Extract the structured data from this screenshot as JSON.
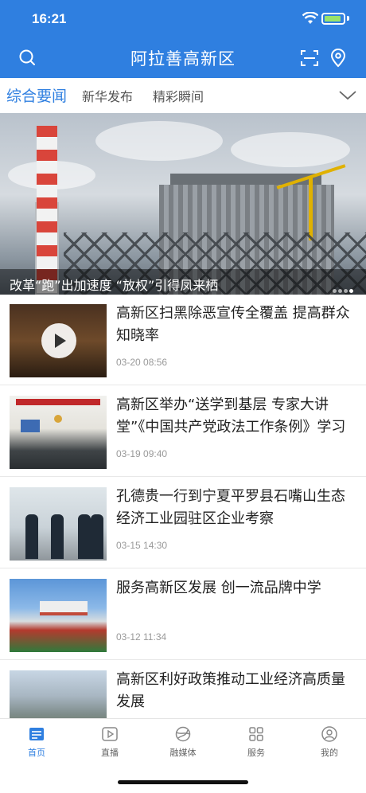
{
  "status_bar": {
    "time": "16:21"
  },
  "header": {
    "title": "阿拉善高新区"
  },
  "tabs": [
    {
      "label": "综合要闻",
      "active": true
    },
    {
      "label": "新华发布",
      "active": false
    },
    {
      "label": "精彩瞬间",
      "active": false
    }
  ],
  "hero": {
    "caption": "改革“跑”出加速度 “放权”引得凤来栖",
    "slide_count": 4,
    "current_slide": 4
  },
  "news": [
    {
      "title": "高新区扫黑除恶宣传全覆盖 提高群众知晓率",
      "date": "03-20 08:56",
      "video": true
    },
    {
      "title": "高新区举办“送学到基层 专家大讲堂”《中国共产党政法工作条例》学习",
      "date": "03-19 09:40",
      "video": false
    },
    {
      "title": "孔德贵一行到宁夏平罗县石嘴山生态经济工业园驻区企业考察",
      "date": "03-15 14:30",
      "video": false
    },
    {
      "title": "服务高新区发展 创一流品牌中学",
      "date": "03-12 11:34",
      "video": false
    },
    {
      "title": "高新区利好政策推动工业经济高质量发展",
      "date": "",
      "video": false
    }
  ],
  "bottom_nav": [
    {
      "label": "首页",
      "icon": "news-icon",
      "active": true
    },
    {
      "label": "直播",
      "icon": "play-icon",
      "active": false
    },
    {
      "label": "融媒体",
      "icon": "globe-icon",
      "active": false
    },
    {
      "label": "服务",
      "icon": "grid-icon",
      "active": false
    },
    {
      "label": "我的",
      "icon": "user-icon",
      "active": false
    }
  ],
  "colors": {
    "brand": "#2f7fe0",
    "background": "#ffffff",
    "muted_text": "#999999"
  }
}
